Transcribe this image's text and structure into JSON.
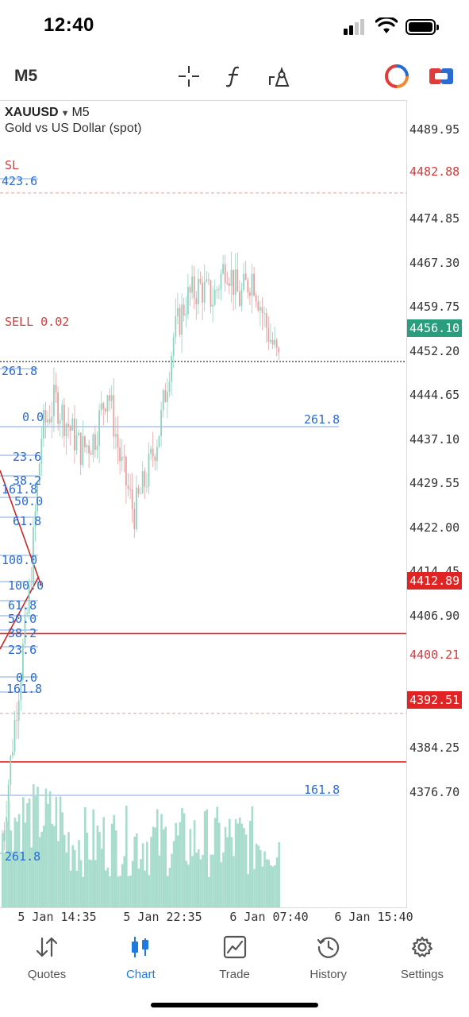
{
  "status_bar": {
    "time": "12:40",
    "icons": [
      "cellular-signal-icon",
      "wifi-icon",
      "battery-icon"
    ]
  },
  "toolbar": {
    "timeframe": "M5",
    "icons": [
      "crosshair-icon",
      "indicator-function-icon",
      "drawing-objects-icon",
      "account-status-icon",
      "one-click-trading-icon"
    ]
  },
  "chart": {
    "symbol": "XAUUSD",
    "timeframe": "M5",
    "description": "Gold vs US Dollar (spot)",
    "price_ticks": [
      "4489.95",
      "4474.85",
      "4467.30",
      "4459.75",
      "4452.20",
      "4444.65",
      "4437.10",
      "4429.55",
      "4422.00",
      "4414.45",
      "4406.90",
      "4384.25",
      "4376.70"
    ],
    "price_tags": {
      "sl": "4482.88",
      "current": "4456.10",
      "level_1": "4412.89",
      "tp": "4400.21",
      "level_2": "4392.51"
    },
    "time_ticks": [
      "5 Jan 14:35",
      "5 Jan 22:35",
      "6 Jan 07:40",
      "6 Jan 15:40"
    ],
    "order_labels": {
      "sl": "SL",
      "sell": "SELL 0.02"
    },
    "fibo_labels": {
      "f1": "423.6",
      "f2": "261.8",
      "f3": "0.0",
      "f4": "261.8",
      "f5": "23.6",
      "f6": "38.2",
      "f7": "161.8",
      "f8": "50.0",
      "f9": "61.8",
      "f10": "100.0",
      "f11": "100.0",
      "f12": "61.8",
      "f13": "50.0",
      "f14": "38.2",
      "f15": "23.6",
      "f16": "0.0",
      "f17": "161.8",
      "f18": "161.8",
      "f19": "261.8"
    },
    "colors": {
      "bull_candle": "#8fd3c1",
      "bear_candle": "#e6a0a0",
      "volume": "#a8dccd",
      "fibo": "#2a6bd0",
      "order_line": "#d23b3b",
      "current_price_tag": "#2a9d7e"
    }
  },
  "chart_data": {
    "type": "candlestick",
    "symbol": "XAUUSD",
    "ylim": [
      4369.15,
      4497.5
    ],
    "x": [
      "5 Jan 14:35",
      "5 Jan 22:35",
      "6 Jan 07:40",
      "6 Jan 15:40"
    ],
    "close_path": [
      4380,
      4400,
      4418,
      4445,
      4450,
      4446,
      4442,
      4444,
      4452,
      4440,
      4432,
      4438,
      4446,
      4460,
      4466,
      4468,
      4466,
      4472,
      4466,
      4470,
      4462,
      4456
    ],
    "last_price": 4456.1
  },
  "bottom_nav": {
    "items": [
      {
        "label": "Quotes",
        "icon": "quotes-arrows-icon"
      },
      {
        "label": "Chart",
        "icon": "chart-candles-icon"
      },
      {
        "label": "Trade",
        "icon": "trade-chart-icon"
      },
      {
        "label": "History",
        "icon": "history-clock-icon"
      },
      {
        "label": "Settings",
        "icon": "settings-gear-icon"
      }
    ],
    "active": "Chart"
  }
}
